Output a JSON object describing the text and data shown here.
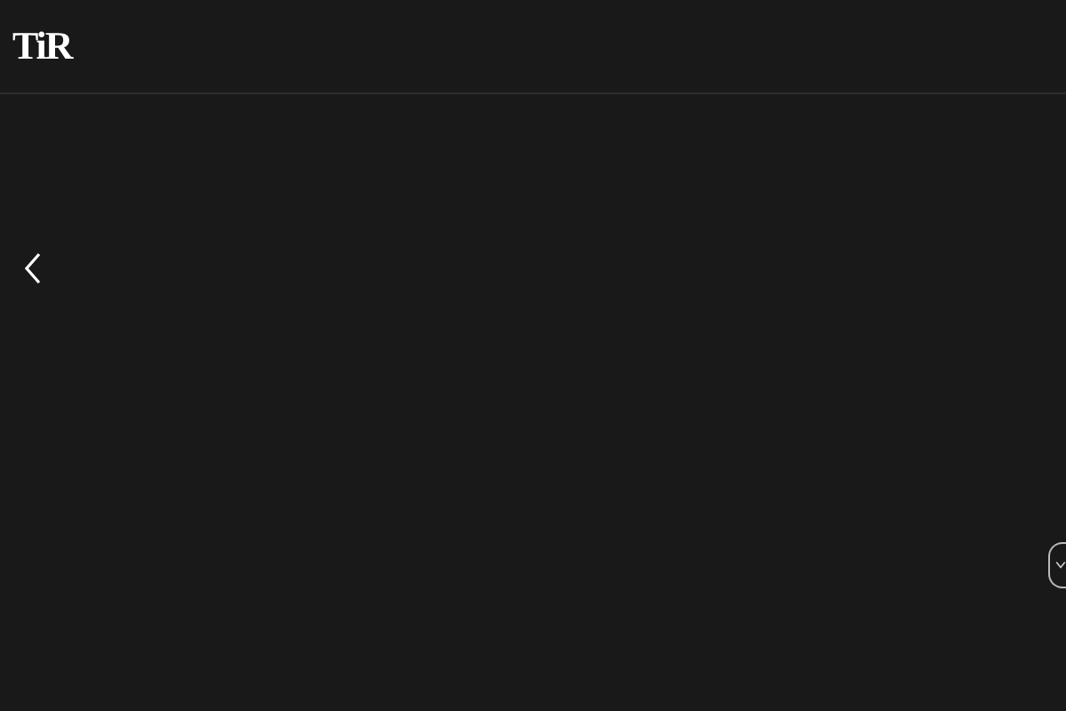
{
  "header": {
    "logo": "TiR"
  }
}
